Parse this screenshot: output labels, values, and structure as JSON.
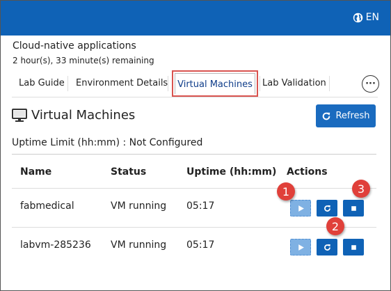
{
  "header": {
    "language": "EN",
    "language_icon": "globe-icon",
    "color": "#0f62b6"
  },
  "lab": {
    "title": "Cloud-native applications",
    "remaining": "2 hour(s), 33 minute(s) remaining"
  },
  "tabs": [
    {
      "label": "Lab Guide",
      "active": false
    },
    {
      "label": "Environment Details",
      "active": false
    },
    {
      "label": "Virtual Machines",
      "active": true
    },
    {
      "label": "Lab Validation",
      "active": false
    }
  ],
  "more_icon": "ellipsis-icon",
  "section": {
    "title": "Virtual Machines",
    "icon": "monitor-icon",
    "refresh_label": "Refresh",
    "uptime_limit": "Uptime Limit (hh:mm) : Not Configured"
  },
  "table": {
    "columns": [
      "Name",
      "Status",
      "Uptime (hh:mm)",
      "Actions"
    ],
    "rows": [
      {
        "name": "fabmedical",
        "status": "VM running",
        "uptime": "05:17"
      },
      {
        "name": "labvm-285236",
        "status": "VM running",
        "uptime": "05:17"
      }
    ]
  },
  "callouts": [
    "1",
    "2",
    "3"
  ],
  "colors": {
    "accent": "#1a6bbf",
    "highlight_border": "#d9534f",
    "callout": "#e0403a"
  }
}
